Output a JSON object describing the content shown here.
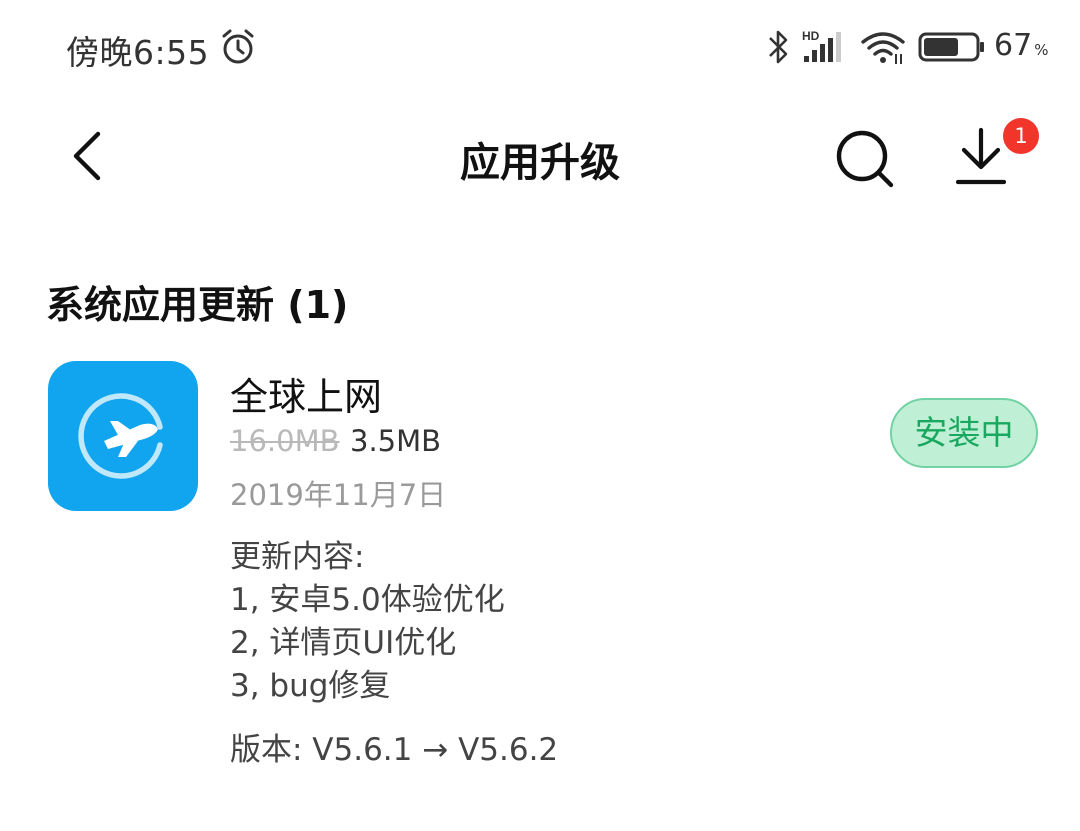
{
  "status_bar": {
    "time": "傍晚6:55",
    "network_type": "HD",
    "battery_percent": "67",
    "battery_unit": "%",
    "battery_level": 0.67,
    "icons": [
      "alarm-icon",
      "bluetooth-icon",
      "signal-icon",
      "wifi-icon",
      "battery-icon"
    ]
  },
  "header": {
    "title": "应用升级",
    "download_badge": "1",
    "icons": [
      "back-icon",
      "search-icon",
      "download-icon"
    ]
  },
  "section": {
    "title": "系统应用更新 (1)"
  },
  "app": {
    "name": "全球上网",
    "old_size": "16.0MB",
    "new_size": "3.5MB",
    "date": "2019年11月7日",
    "install_label": "安装中",
    "notes_title": "更新内容:",
    "notes": [
      "1, 安卓5.0体验优化",
      "2, 详情页UI优化",
      "3, bug修复"
    ],
    "version": "版本: V5.6.1 → V5.6.2",
    "icon": "plane-icon"
  },
  "colors": {
    "app_icon_bg": "#11a4ef",
    "install_bg": "#bff0d6",
    "install_text": "#1aa75f",
    "badge": "#f1352b"
  }
}
